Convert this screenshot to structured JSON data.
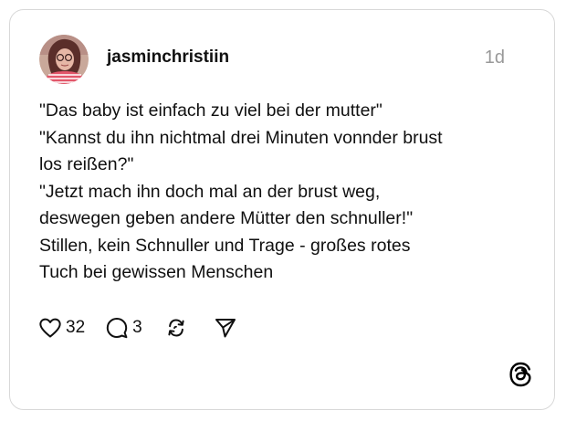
{
  "post": {
    "username": "jasminchristiin",
    "time": "1d",
    "lines": [
      "\"Das baby ist einfach zu viel bei der mutter\"",
      "\"Kannst du ihn nichtmal drei Minuten vonnder brust",
      "los reißen?\"",
      "\"Jetzt mach ihn doch mal an der brust weg,",
      "deswegen geben andere Mütter den schnuller!\"",
      "Stillen, kein Schnuller und Trage - großes rotes",
      "Tuch bei gewissen Menschen"
    ]
  },
  "actions": {
    "like_icon": "heart-icon",
    "like_count": "32",
    "reply_icon": "comment-icon",
    "reply_count": "3",
    "repost_icon": "repost-icon",
    "share_icon": "send-icon"
  },
  "branding": {
    "logo_icon": "threads-logo-icon"
  }
}
